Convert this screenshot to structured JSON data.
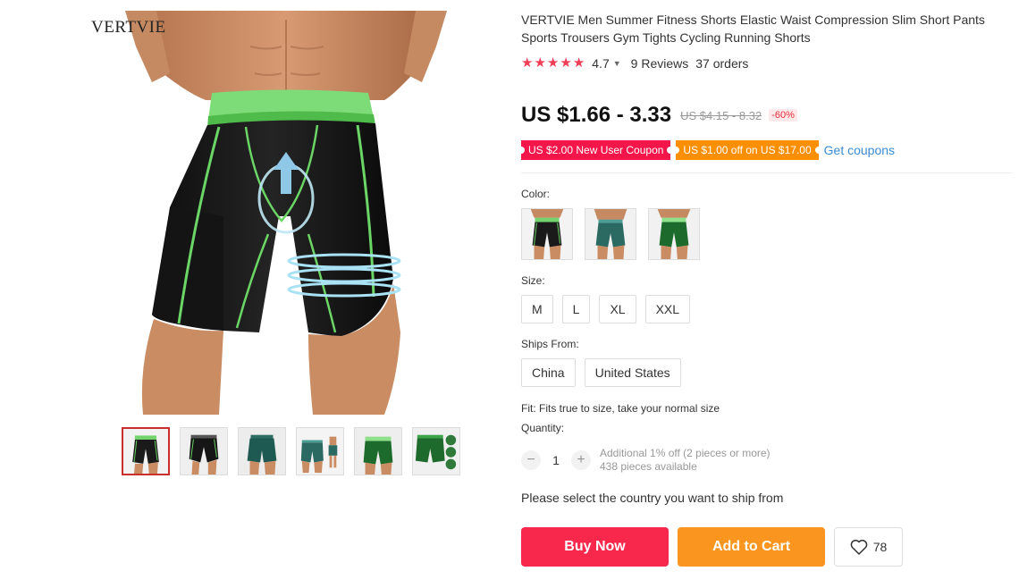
{
  "gallery": {
    "brand_logo": "VERTVIE",
    "thumbnails": [
      {
        "name": "thumb-black-front"
      },
      {
        "name": "thumb-black-detail"
      },
      {
        "name": "thumb-teal-back"
      },
      {
        "name": "thumb-teal-front"
      },
      {
        "name": "thumb-green-front"
      },
      {
        "name": "thumb-green-detail"
      }
    ],
    "active_index": 0
  },
  "product": {
    "title": "VERTVIE Men Summer Fitness Shorts Elastic Waist Compression Slim Short Pants Sports Trousers Gym Tights Cycling Running Shorts",
    "rating": "4.7",
    "reviews": "9 Reviews",
    "orders": "37 orders",
    "star_icon": "★",
    "price": "US $1.66 - 3.33",
    "original_price": "US $4.15 - 8.32",
    "discount": "-60%",
    "coupons": [
      {
        "label": "US $2.00 New User Coupon",
        "color": "#f4154a"
      },
      {
        "label": "US $1.00 off on US $17.00",
        "color": "#fb8f00"
      }
    ],
    "get_coupons": "Get coupons"
  },
  "options": {
    "color_label": "Color:",
    "color_swatches": [
      "black",
      "teal",
      "green"
    ],
    "size_label": "Size:",
    "sizes": [
      "M",
      "L",
      "XL",
      "XXL"
    ],
    "ships_label": "Ships From:",
    "ships_from": [
      "China",
      "United States"
    ],
    "fit": "Fit: Fits true to size, take your normal size"
  },
  "quantity": {
    "label": "Quantity:",
    "minus": "−",
    "value": "1",
    "plus": "+",
    "additional": "Additional 1% off (2 pieces or more)",
    "available": "438 pieces available"
  },
  "ship_note": "Please select the country you want to ship from",
  "actions": {
    "buy_now": "Buy Now",
    "add_to_cart": "Add to Cart",
    "wishlist_count": "78"
  },
  "colors": {
    "accent_red": "#f8284d",
    "accent_orange": "#fa9520",
    "link_blue": "#3a8bd4",
    "star": "#f23d56"
  }
}
